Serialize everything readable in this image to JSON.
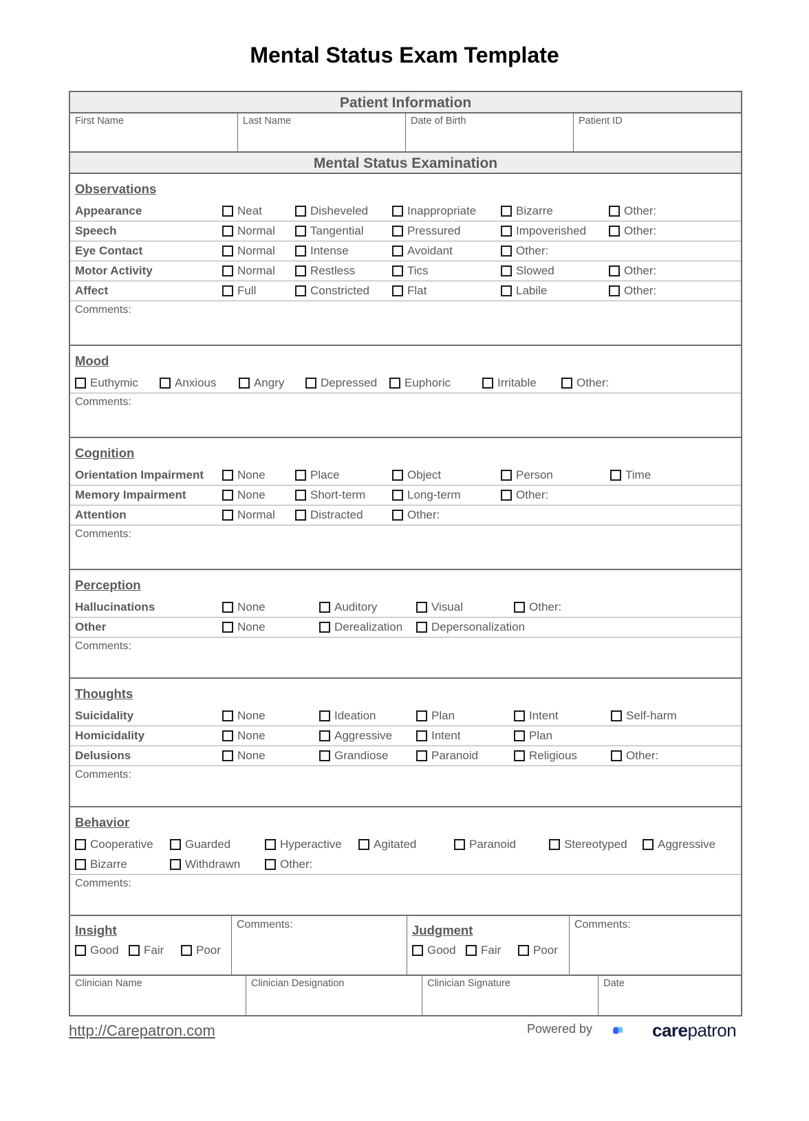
{
  "title": "Mental Status Exam Template",
  "patient_info": {
    "header": "Patient Information",
    "fields": [
      "First Name",
      "Last Name",
      "Date of Birth",
      "Patient ID"
    ]
  },
  "mse_header": "Mental Status Examination",
  "comments_label": "Comments:",
  "observations": {
    "title": "Observations",
    "rows": [
      {
        "label": "Appearance",
        "options": [
          "Neat",
          "Disheveled",
          "Inappropriate",
          "Bizarre",
          "Other:"
        ]
      },
      {
        "label": "Speech",
        "options": [
          "Normal",
          "Tangential",
          "Pressured",
          "Impoverished",
          "Other:"
        ]
      },
      {
        "label": "Eye Contact",
        "options": [
          "Normal",
          "Intense",
          "Avoidant",
          "Other:"
        ]
      },
      {
        "label": "Motor Activity",
        "options": [
          "Normal",
          "Restless",
          "Tics",
          "Slowed",
          "Other:"
        ]
      },
      {
        "label": "Affect",
        "options": [
          "Full",
          "Constricted",
          "Flat",
          "Labile",
          "Other:"
        ]
      }
    ]
  },
  "mood": {
    "title": "Mood",
    "options": [
      "Euthymic",
      "Anxious",
      "Angry",
      "Depressed",
      "Euphoric",
      "Irritable",
      "Other:"
    ]
  },
  "cognition": {
    "title": "Cognition",
    "rows": [
      {
        "label": "Orientation Impairment",
        "options": [
          "None",
          "Place",
          "Object",
          "Person",
          "Time"
        ]
      },
      {
        "label": "Memory Impairment",
        "options": [
          "None",
          "Short-term",
          "Long-term",
          "Other:"
        ]
      },
      {
        "label": "Attention",
        "options": [
          "Normal",
          "Distracted",
          "Other:"
        ]
      }
    ]
  },
  "perception": {
    "title": "Perception",
    "rows": [
      {
        "label": "Hallucinations",
        "options": [
          "None",
          "Auditory",
          "Visual",
          "Other:"
        ]
      },
      {
        "label": "Other",
        "options": [
          "None",
          "Derealization",
          "Depersonalization"
        ]
      }
    ]
  },
  "thoughts": {
    "title": "Thoughts",
    "rows": [
      {
        "label": "Suicidality",
        "options": [
          "None",
          "Ideation",
          "Plan",
          "Intent",
          "Self-harm"
        ]
      },
      {
        "label": "Homicidality",
        "options": [
          "None",
          "Aggressive",
          "Intent",
          "Plan"
        ]
      },
      {
        "label": "Delusions",
        "options": [
          "None",
          "Grandiose",
          "Paranoid",
          "Religious",
          "Other:"
        ]
      }
    ]
  },
  "behavior": {
    "title": "Behavior",
    "row1": [
      "Cooperative",
      "Guarded",
      "Hyperactive",
      "Agitated",
      "Paranoid",
      "Stereotyped",
      "Aggressive"
    ],
    "row2": [
      "Bizarre",
      "Withdrawn",
      "Other:"
    ]
  },
  "insight": {
    "title": "Insight",
    "options": [
      "Good",
      "Fair",
      "Poor"
    ]
  },
  "judgment": {
    "title": "Judgment",
    "options": [
      "Good",
      "Fair",
      "Poor"
    ]
  },
  "clinician": {
    "fields": [
      "Clinician Name",
      "Clinician Designation",
      "Clinician Signature",
      "Date"
    ]
  },
  "footer": {
    "link": "http://Carepatron.com",
    "powered_by": "Powered by",
    "brand_bold": "care",
    "brand_rest": "patron",
    "brand_colors": {
      "dark_blue": "#3b5bfd",
      "light_blue": "#5ec4f7",
      "text": "#111a3a"
    }
  }
}
